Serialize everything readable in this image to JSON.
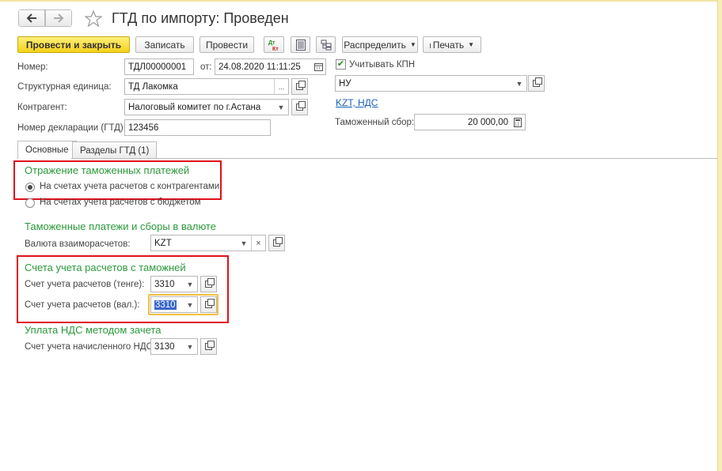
{
  "header": {
    "title": "ГТД по импорту: Проведен",
    "back_icon": "arrow-left-icon",
    "forward_icon": "arrow-right-icon",
    "star_icon": "star-icon"
  },
  "toolbar": {
    "post_close": "Провести и закрыть",
    "save": "Записать",
    "post": "Провести",
    "distribute": "Распределить",
    "print": "Печать"
  },
  "form": {
    "number_label": "Номер:",
    "number_value": "ТДЛ00000001",
    "date_label": "от:",
    "date_value": "24.08.2020 11:11:25",
    "kpn_label": "Учитывать КПН",
    "kpn_checked": true,
    "unit_label": "Структурная единица:",
    "unit_value": "ТД Лакомка",
    "nu_value": "НУ",
    "contractor_label": "Контрагент:",
    "contractor_value": "Налоговый комитет по г.Астана",
    "kzt_vat_link": "KZT, НДС",
    "gtd_label": "Номер декларации (ГТД):",
    "gtd_value": "123456",
    "customs_fee_label": "Таможенный сбор:",
    "customs_fee_value": "20 000,00"
  },
  "tabs": [
    {
      "label": "Основные"
    },
    {
      "label": "Разделы ГТД (1)"
    }
  ],
  "sections": {
    "reflection_title": "Отражение таможенных платежей",
    "radio1": "На счетах учета расчетов с контрагентами",
    "radio2": "На счетах учета расчетов с бюджетом",
    "currency_title": "Таможенные платежи и сборы в валюте",
    "currency_label": "Валюта взаиморасчетов:",
    "currency_value": "KZT",
    "accounts_title": "Счета учета расчетов с таможней",
    "acc_tenge_label": "Счет учета расчетов (тенге):",
    "acc_tenge_value": "3310",
    "acc_val_label": "Счет учета расчетов (вал.):",
    "acc_val_value": "3310",
    "vat_title": "Уплата НДС методом зачета",
    "vat_label": "Счет учета начисленного НДС:",
    "vat_value": "3130"
  }
}
